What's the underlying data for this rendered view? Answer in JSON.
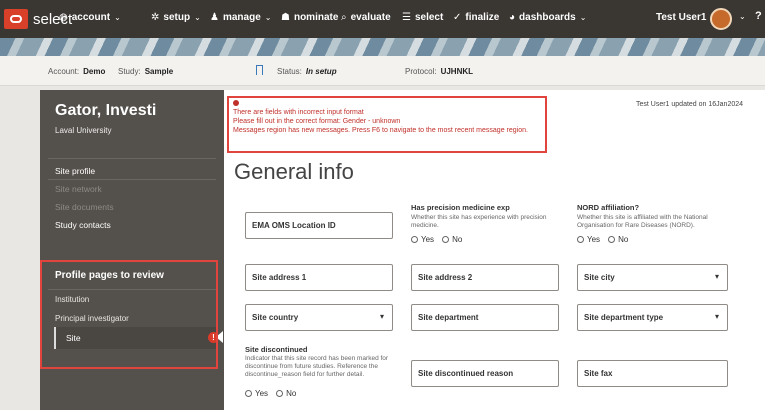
{
  "nav": {
    "brand": "select",
    "items": [
      {
        "label": "account",
        "icon": "globe-icon",
        "glyph": "◍",
        "chevron": true
      },
      {
        "label": "setup",
        "icon": "gear-icon",
        "glyph": "✲",
        "chevron": true
      },
      {
        "label": "manage",
        "icon": "person-icon",
        "glyph": "♟",
        "chevron": true
      },
      {
        "label": "nominate",
        "icon": "people-icon",
        "glyph": "☗",
        "chevron": false
      },
      {
        "label": "evaluate",
        "icon": "search-icon",
        "glyph": "⌕",
        "chevron": false
      },
      {
        "label": "select",
        "icon": "list-icon",
        "glyph": "☰",
        "chevron": false
      },
      {
        "label": "finalize",
        "icon": "check-circle-icon",
        "glyph": "✓",
        "chevron": false
      },
      {
        "label": "dashboards",
        "icon": "pie-chart-icon",
        "glyph": "◕",
        "chevron": true
      }
    ],
    "user": "Test User1",
    "help": "?"
  },
  "context": {
    "account_label": "Account:",
    "account_value": "Demo",
    "study_label": "Study:",
    "study_value": "Sample",
    "status_label": "Status:",
    "status_value": "In setup",
    "protocol_label": "Protocol:",
    "protocol_value": "UJHNKL"
  },
  "sidebar": {
    "title": "Gator, Investi",
    "subtitle": "Laval University",
    "links": [
      "Site profile",
      "Site network",
      "Site documents",
      "Study contacts"
    ],
    "review_title": "Profile pages to review",
    "review_items": [
      "Institution",
      "Principal investigator",
      "Site"
    ],
    "site_alert": "!"
  },
  "messages": {
    "lines": [
      "There are fields with incorrect input format",
      "Please fill out in the correct format: Gender - unknown",
      "Messages region has new messages. Press F6 to navigate to the most recent message region."
    ],
    "updated": "Test User1 updated on 16Jan2024"
  },
  "main": {
    "title": "General info",
    "ema_field": "EMA OMS Location ID",
    "precision": {
      "title": "Has precision medicine exp",
      "help": "Whether this site has experience with precision medicine."
    },
    "nord": {
      "title": "NORD affiliation?",
      "help": "Whether this site is affiliated with the National Organisation for Rare Diseases (NORD)."
    },
    "discontinued": {
      "title": "Site discontinued",
      "help": "Indicator that this site record has been marked for discontinue from future studies. Reference the discontinue_reason field for further detail."
    },
    "yes": "Yes",
    "no": "No",
    "fields": {
      "address1": "Site address 1",
      "address2": "Site address 2",
      "city": "Site city",
      "country": "Site country",
      "department": "Site department",
      "department_type": "Site department type",
      "discontinued_reason": "Site discontinued reason",
      "fax": "Site fax"
    }
  },
  "colors": {
    "topbar": "#3a3632",
    "brand_red": "#d9402a",
    "sidebar": "#54504b",
    "error": "#c0302a",
    "highlight_box": "#e0443c"
  }
}
